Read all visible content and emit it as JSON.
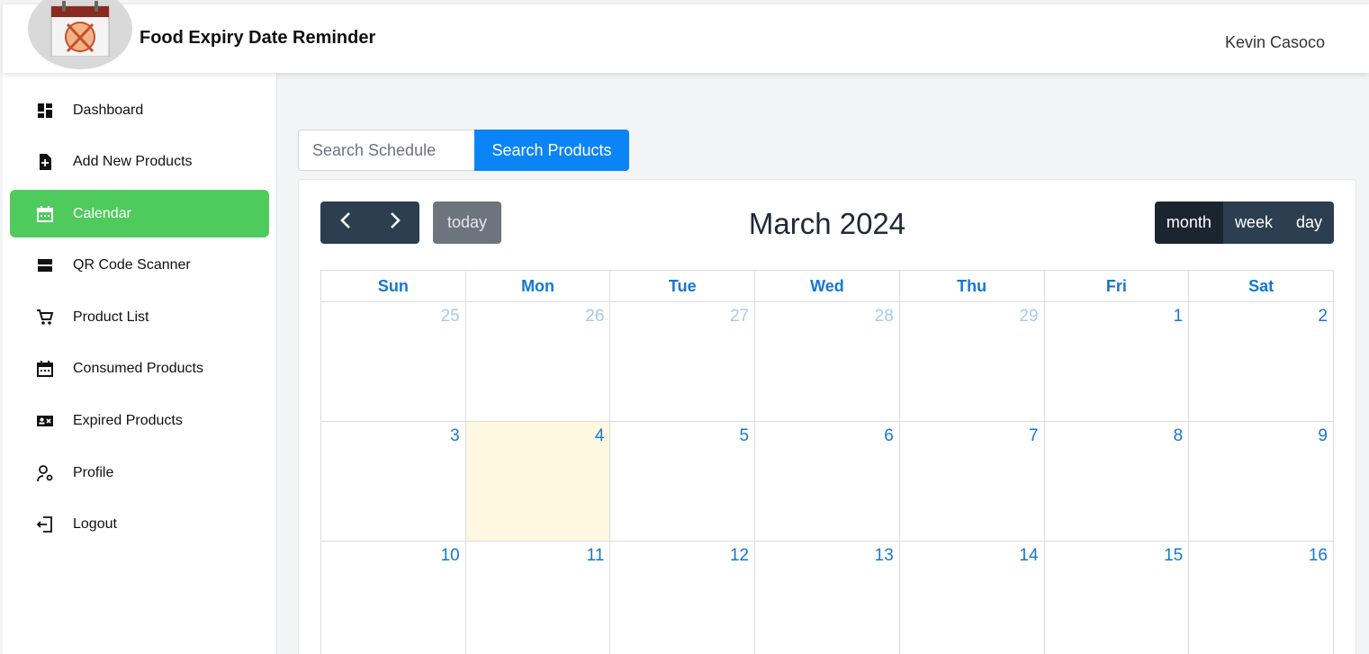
{
  "header": {
    "app_title": "Food Expiry Date Reminder",
    "user_name": "Kevin Casoco"
  },
  "sidebar": {
    "items": [
      {
        "label": "Dashboard",
        "icon": "dashboard-icon"
      },
      {
        "label": "Add New Products",
        "icon": "add-file-icon"
      },
      {
        "label": "Calendar",
        "icon": "calendar-icon",
        "active": true
      },
      {
        "label": "QR Code Scanner",
        "icon": "scanner-icon"
      },
      {
        "label": "Product List",
        "icon": "cart-icon"
      },
      {
        "label": "Consumed Products",
        "icon": "calendar-icon"
      },
      {
        "label": "Expired Products",
        "icon": "id-card-icon"
      },
      {
        "label": "Profile",
        "icon": "user-gear-icon"
      },
      {
        "label": "Logout",
        "icon": "logout-icon"
      }
    ]
  },
  "search": {
    "placeholder": "Search Schedule",
    "button_label": "Search Products"
  },
  "calendar": {
    "title": "March 2024",
    "today_label": "today",
    "views": [
      "month",
      "week",
      "day"
    ],
    "active_view": "month",
    "weekdays": [
      "Sun",
      "Mon",
      "Tue",
      "Wed",
      "Thu",
      "Fri",
      "Sat"
    ],
    "weeks": [
      [
        "25",
        "26",
        "27",
        "28",
        "29",
        "1",
        "2"
      ],
      [
        "3",
        "4",
        "5",
        "6",
        "7",
        "8",
        "9"
      ],
      [
        "10",
        "11",
        "12",
        "13",
        "14",
        "15",
        "16"
      ]
    ]
  },
  "colors": {
    "accent_green": "#4fcb5e",
    "primary_blue": "#0b84f5",
    "dark_button": "#2c3e50",
    "today_highlight": "#fef8e0"
  }
}
